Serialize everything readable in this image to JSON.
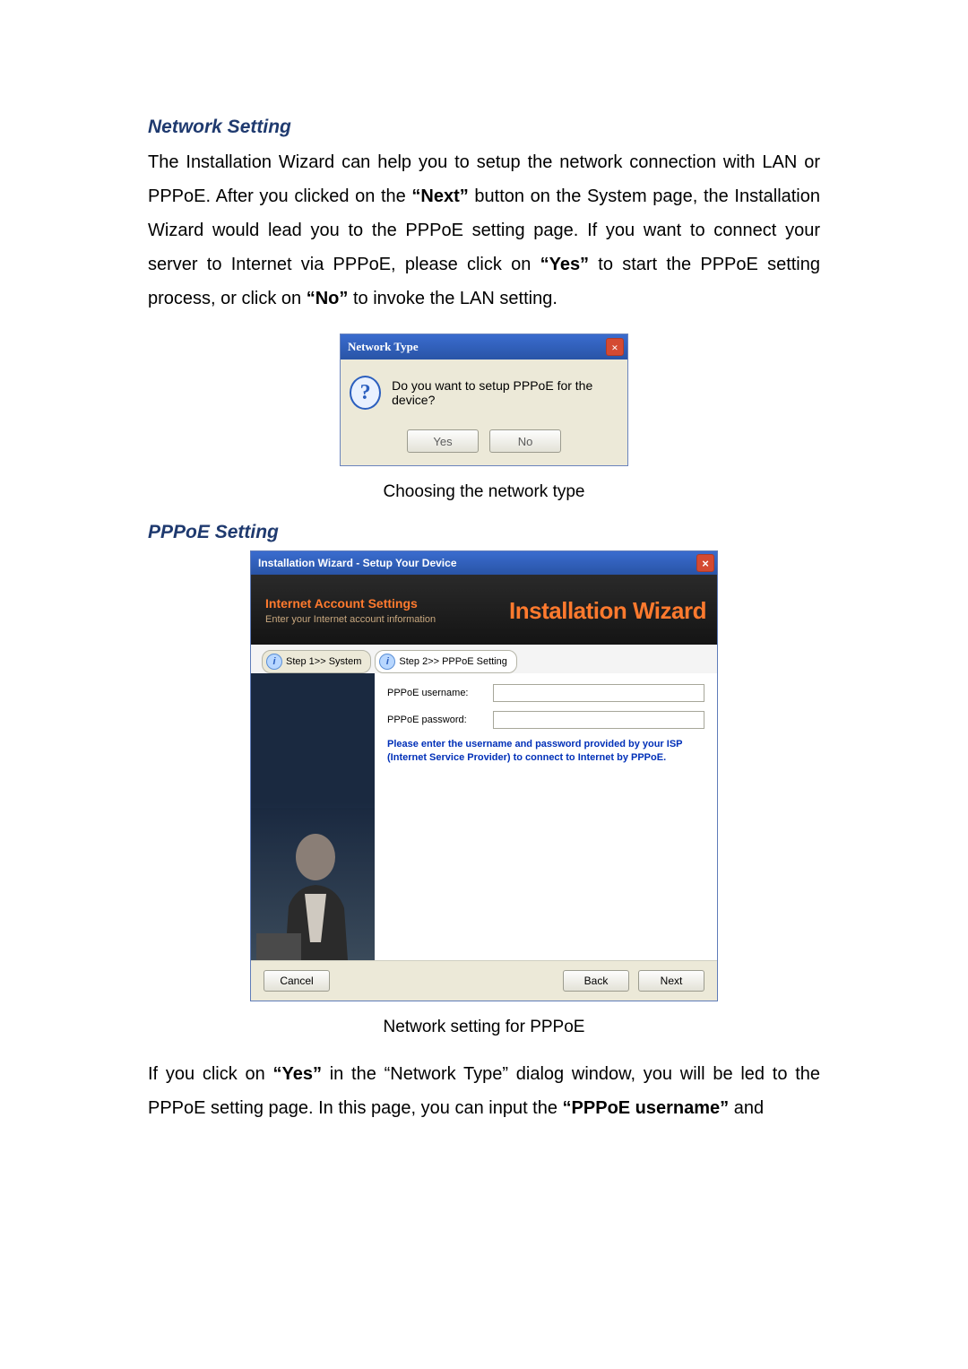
{
  "headings": {
    "network_setting": "Network Setting",
    "pppoe_setting": "PPPoE Setting"
  },
  "para1_parts": [
    "The Installation Wizard can help you to setup the network connection with LAN or PPPoE. After you clicked on the ",
    "“Next”",
    " button on the System page, the Installation Wizard would lead you to the PPPoE setting page. If you want to connect your server to Internet via PPPoE, please click on ",
    "“Yes”",
    " to start the PPPoE setting process, or click on ",
    "“No”",
    " to invoke the LAN setting."
  ],
  "dialog1": {
    "title": "Network Type",
    "question_mark": "?",
    "message": "Do you want to setup PPPoE for the device?",
    "yes": "Yes",
    "no": "No",
    "close": "×"
  },
  "caption1": "Choosing the network type",
  "dialog2": {
    "title": "Installation Wizard - Setup Your Device",
    "close": "×",
    "header_title": "Internet Account Settings",
    "header_sub": "Enter your Internet account information",
    "brand": "Installation Wizard",
    "tab1": "Step 1>> System",
    "tab2": "Step 2>> PPPoE Setting",
    "tab_icon": "i",
    "field_user_label": "PPPoE username:",
    "field_pass_label": "PPPoE password:",
    "hint": "Please enter the username and password provided by your ISP (Internet Service Provider) to connect to Internet by PPPoE.",
    "cancel": "Cancel",
    "back": "Back",
    "next": "Next"
  },
  "caption2": "Network setting for PPPoE",
  "para2_parts": [
    "If you click on ",
    "“Yes”",
    " in the “Network Type” dialog window, you will be led to the PPPoE setting page. In this page, you can input the ",
    "“PPPoE username”",
    " and"
  ]
}
